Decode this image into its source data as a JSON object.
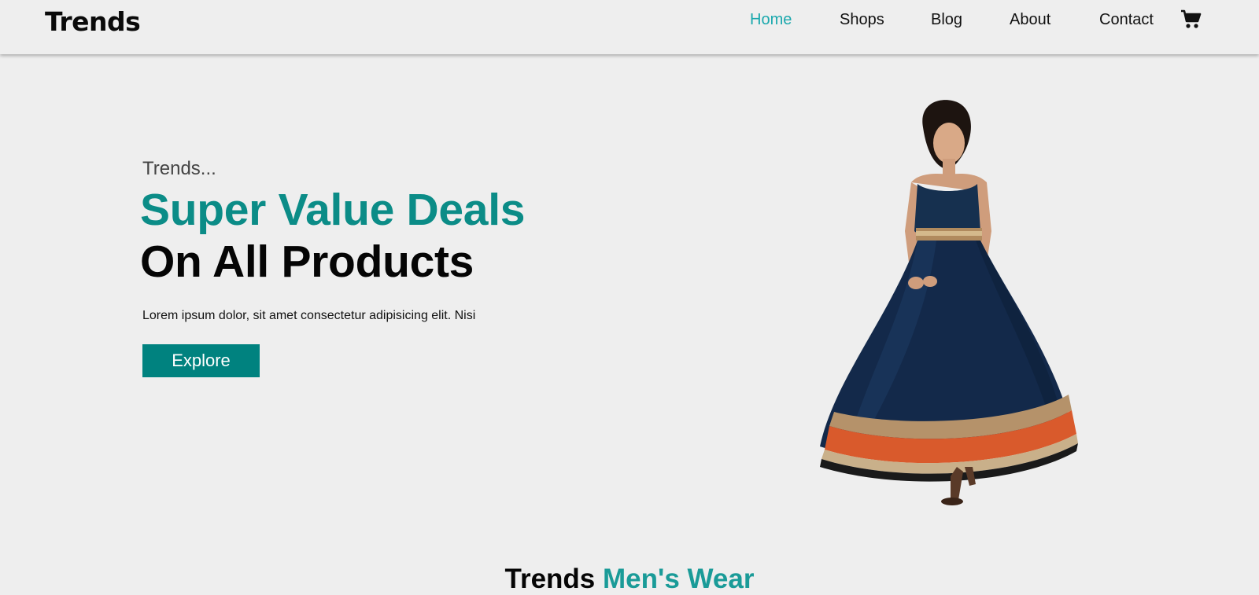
{
  "brand": {
    "logo_text": "Trends"
  },
  "nav": {
    "items": [
      {
        "label": "Home",
        "active": true
      },
      {
        "label": "Shops",
        "active": false
      },
      {
        "label": "Blog",
        "active": false
      },
      {
        "label": "About",
        "active": false
      },
      {
        "label": "Contact",
        "active": false
      }
    ],
    "cart_icon": "shopping-cart-icon"
  },
  "hero": {
    "tagline": "Trends...",
    "headline_accent": "Super Value Deals",
    "headline_main": "On All Products",
    "description": "Lorem ipsum dolor, sit amet consectetur adipisicing elit. Nisi",
    "cta_label": "Explore"
  },
  "section": {
    "title_prefix": "Trends",
    "title_accent": "Men's Wear"
  },
  "colors": {
    "accent": "#0b8c87",
    "nav_active": "#1aa8ad",
    "button_bg": "#00827f",
    "background": "#eeeeee"
  }
}
